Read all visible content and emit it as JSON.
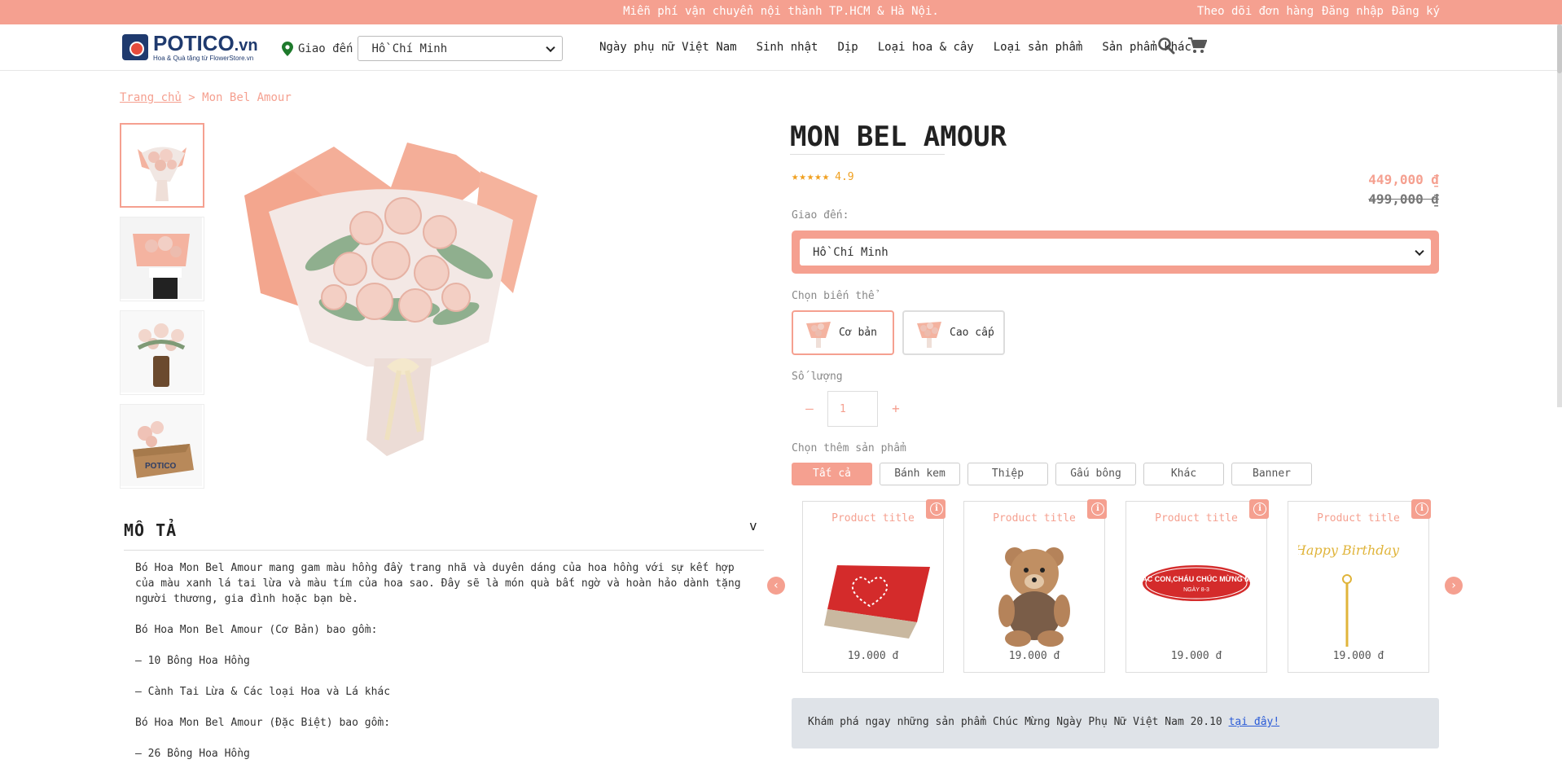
{
  "topbar": {
    "promo": "Miễn phí vận chuyển nội thành TP.HCM & Hà Nội.",
    "track_order": "Theo dõi đơn hàng",
    "login": "Đăng nhập",
    "register": "Đăng ký"
  },
  "logo": {
    "name": "POTICO",
    "suffix": ".vn",
    "tagline": "Hoa & Quà tặng từ FlowerStore.vn"
  },
  "header": {
    "deliver_label": "Giao đến",
    "city": "Hồ Chí Minh",
    "nav": [
      "Ngày phụ nữ Việt Nam",
      "Sinh nhật",
      "Dịp",
      "Loại hoa & cây",
      "Loại sản phẩm",
      "Sản phẩm khác"
    ]
  },
  "breadcrumb": {
    "home": "Trang chủ",
    "separator": ">",
    "current": "Mon Bel Amour"
  },
  "product": {
    "title": "MON BEL AMOUR",
    "rating": "4.9",
    "price": "449,000 ₫",
    "old_price": "499,000 ₫",
    "deliver_label": "Giao đến:",
    "city": "Hồ Chí Minh",
    "variant_label": "Chọn biến thể",
    "variants": [
      "Cơ bản",
      "Cao cấp"
    ],
    "qty_label": "Số lượng",
    "qty": "1",
    "qty_minus": "–",
    "qty_plus": "+"
  },
  "addons": {
    "label": "Chọn thêm sản phẩm",
    "tabs": [
      "Tất cả",
      "Bánh kem",
      "Thiệp",
      "Gấu bông",
      "Khác",
      "Banner"
    ],
    "cards": [
      {
        "title": "Product title",
        "price": "19.000 đ"
      },
      {
        "title": "Product title",
        "price": "19.000 đ"
      },
      {
        "title": "Product title",
        "price": "19.000 đ",
        "banner_text": "CÁC CON,CHÁU CHÚC MỪNG MÁ",
        "banner_sub": "NGÀY 8-3"
      },
      {
        "title": "Product title",
        "price": "19.000 đ",
        "topper_text": "Happy Birthday"
      }
    ]
  },
  "description": {
    "title": "MÔ TẢ",
    "paragraphs": [
      "Bó Hoa Mon Bel Amour mang gam màu hồng đầy trang nhã và duyên dáng của hoa hồng với sự kết hợp của màu xanh lá tai lừa và màu tím của hoa sao. Đây sẽ là món quà bất ngờ và hoàn hảo dành tặng người thương, gia đình hoặc bạn bè.",
      "Bó Hoa Mon Bel Amour (Cơ Bản) bao gồm:",
      "– 10 Bông Hoa Hồng",
      "– Cành Tai Lừa & Các loại Hoa và Lá khác",
      "Bó Hoa Mon Bel Amour (Đặc Biệt) bao gồm:",
      "– 26 Bông Hoa Hồng"
    ]
  },
  "explore": {
    "text": "Khám phá ngay những sản phẩm Chúc Mừng Ngày Phụ Nữ Việt Nam 20.10 ",
    "link": "tại đây!"
  },
  "colors": {
    "accent": "#f5a090",
    "brand": "#1f3a6e",
    "link": "#2a5bd7"
  },
  "icons": [
    "location-pin-icon",
    "search-icon",
    "cart-icon",
    "chevron-down-icon",
    "info-icon",
    "arrow-left-icon",
    "arrow-right-icon"
  ]
}
